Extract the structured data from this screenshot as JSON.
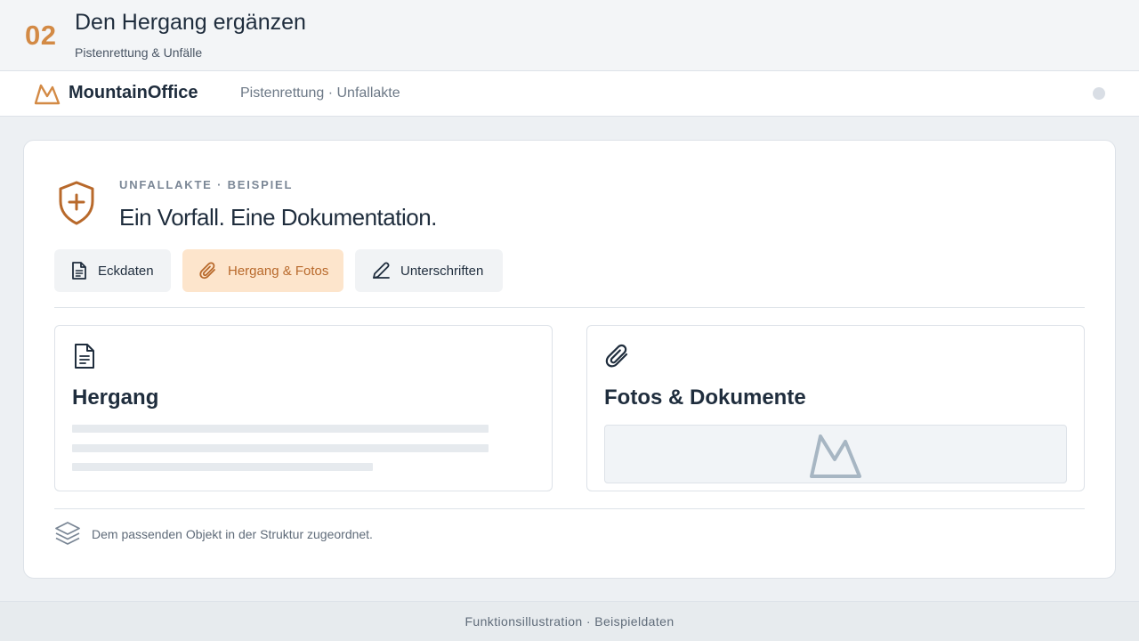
{
  "step": {
    "number": "02",
    "title": "Den Hergang ergänzen",
    "subtitle": "Pistenrettung & Unfälle"
  },
  "navbar": {
    "brand": "MountainOffice",
    "breadcrumb": "Pistenrettung · Unfallakte",
    "logo_icon": "mountain-icon"
  },
  "card": {
    "eyebrow": "UNFALLAKTE · BEISPIEL",
    "heading": "Ein Vorfall. Eine Dokumentation.",
    "header_icon": "shield-plus-icon",
    "tabs": [
      {
        "label": "Eckdaten",
        "icon": "document-icon",
        "active": false
      },
      {
        "label": "Hergang & Fotos",
        "icon": "paperclip-icon",
        "active": true
      },
      {
        "label": "Unterschriften",
        "icon": "pen-icon",
        "active": false
      }
    ],
    "panels": {
      "hergang": {
        "title": "Hergang",
        "icon": "document-icon"
      },
      "fotos": {
        "title": "Fotos & Dokumente",
        "icon": "paperclip-icon",
        "placeholder_icon": "mountain-icon"
      }
    },
    "footnote": "Dem passenden Objekt in der Struktur zugeordnet.",
    "footnote_icon": "layers-icon"
  },
  "footer": {
    "text": "Funktionsillustration · Beispieldaten"
  },
  "colors": {
    "accent": "#d38a45",
    "accent_dark": "#b8692b",
    "active_tab_bg": "#fde5cc",
    "text_primary": "#1f2d3d",
    "background": "#edf0f3"
  }
}
